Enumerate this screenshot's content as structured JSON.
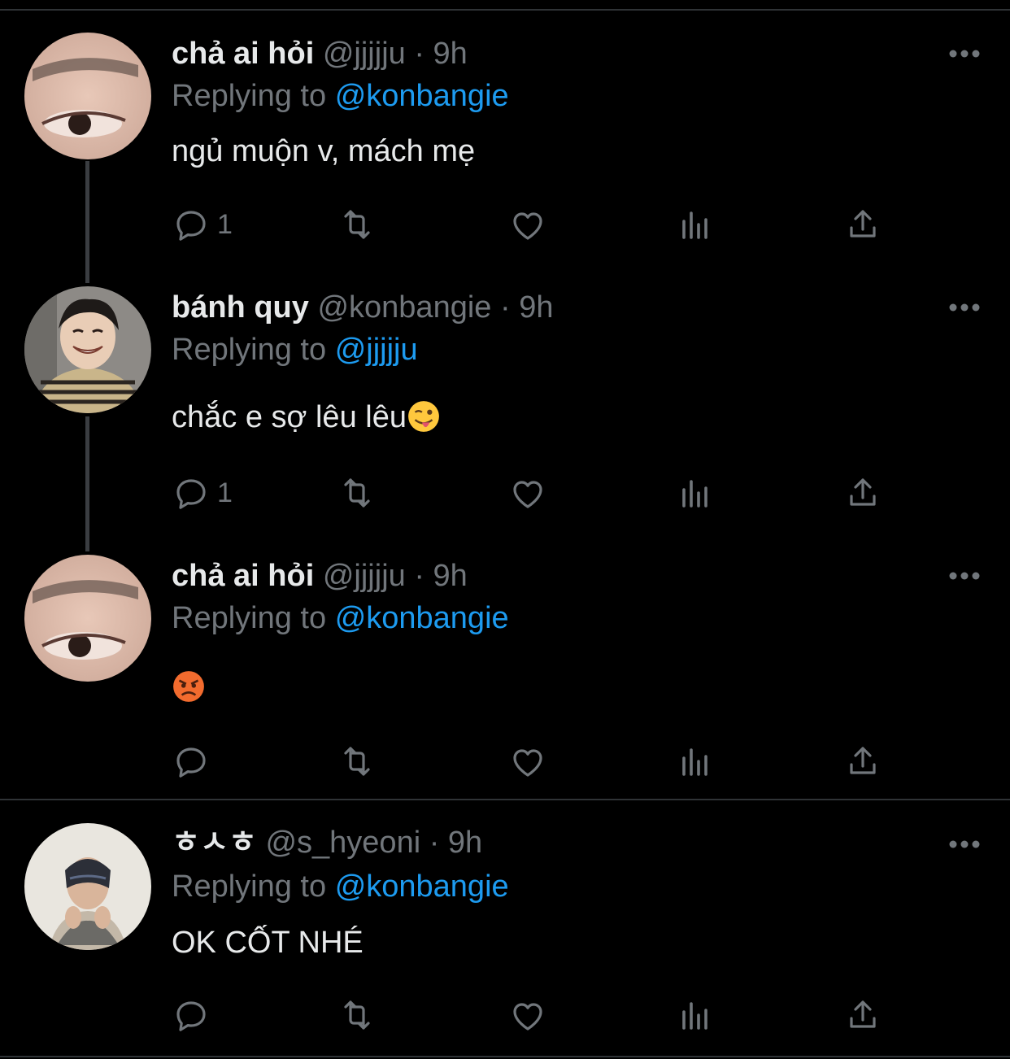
{
  "tweets": [
    {
      "name": "chả ai hỏi",
      "handle": "@jjjjju",
      "time": "9h",
      "replying_label": "Replying to",
      "replying_to": "@konbangie",
      "text": "ngủ muộn v, mách mẹ",
      "reply_count": "1",
      "avatar": "eye-closeup-avatar"
    },
    {
      "name": "bánh quy",
      "handle": "@konbangie",
      "time": "9h",
      "replying_label": "Replying to",
      "replying_to": "@jjjjju",
      "text": "chắc e sợ lêu lêu",
      "emoji": "winking-face-with-tongue",
      "reply_count": "1",
      "avatar": "smiling-person-avatar"
    },
    {
      "name": "chả ai hỏi",
      "handle": "@jjjjju",
      "time": "9h",
      "replying_label": "Replying to",
      "replying_to": "@konbangie",
      "text": "",
      "emoji": "angry-face",
      "reply_count": "",
      "avatar": "eye-closeup-avatar"
    },
    {
      "name": "ㅎㅅㅎ",
      "handle": "@s_hyeoni",
      "time": "9h",
      "replying_label": "Replying to",
      "replying_to": "@konbangie",
      "text": "OK CỐT NHÉ",
      "reply_count": "",
      "avatar": "masked-person-avatar"
    }
  ],
  "separator": "·",
  "colors": {
    "background": "#000000",
    "text": "#e7e9ea",
    "secondary": "#71767b",
    "accent": "#1d9bf0",
    "divider": "#2f3336"
  },
  "icons": [
    "reply-icon",
    "retweet-icon",
    "like-icon",
    "analytics-icon",
    "share-icon",
    "more-icon"
  ]
}
